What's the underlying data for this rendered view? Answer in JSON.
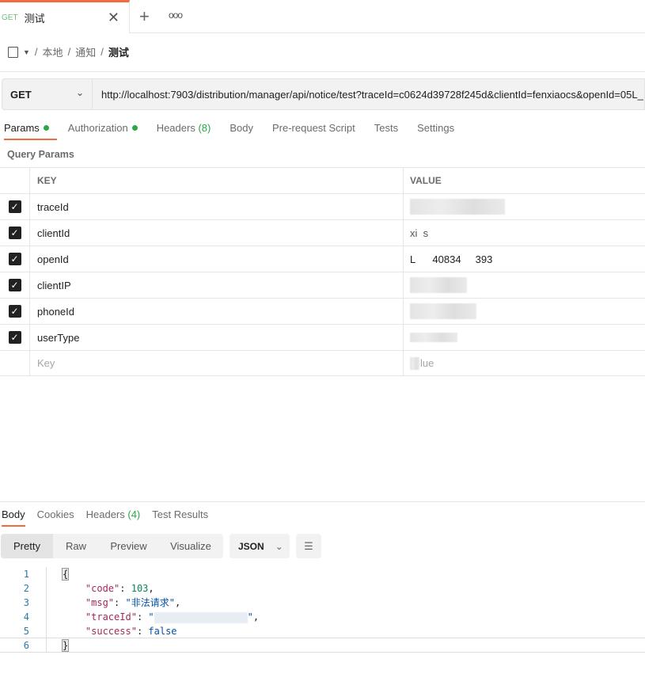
{
  "tab": {
    "method": "GET",
    "title": "测试",
    "close_icon": "close-icon",
    "new_tab_icon": "plus-icon",
    "more_icon": "ellipsis-icon"
  },
  "breadcrumb": {
    "items": [
      "本地",
      "通知"
    ],
    "current": "测试"
  },
  "request": {
    "method": "GET",
    "url": "http://localhost:7903/distribution/manager/api/notice/test?traceId=c0624d39728f245d&clientId=fenxiaocs&openId=05L_"
  },
  "tabs": [
    {
      "label": "Params"
    },
    {
      "label": "Authorization"
    },
    {
      "label": "Headers",
      "count": "(8)"
    },
    {
      "label": "Body"
    },
    {
      "label": "Pre-request Script"
    },
    {
      "label": "Tests"
    },
    {
      "label": "Settings"
    }
  ],
  "query_params": {
    "title": "Query Params",
    "headers": {
      "key": "KEY",
      "value": "VALUE"
    },
    "rows": [
      {
        "key": "traceId",
        "value": ""
      },
      {
        "key": "clientId",
        "value": "xi  s"
      },
      {
        "key": "openId",
        "value": "L      40834     393"
      },
      {
        "key": "clientIP",
        "value": ""
      },
      {
        "key": "phoneId",
        "value": ""
      },
      {
        "key": "userType",
        "value": ""
      }
    ],
    "placeholder": {
      "key": "Key",
      "value": "lue"
    }
  },
  "response": {
    "tabs": [
      {
        "label": "Body"
      },
      {
        "label": "Cookies"
      },
      {
        "label": "Headers",
        "count": "(4)"
      },
      {
        "label": "Test Results"
      }
    ],
    "views": [
      "Pretty",
      "Raw",
      "Preview",
      "Visualize"
    ],
    "format": "JSON",
    "body": {
      "code": "103",
      "msg": "\"非法请求\"",
      "success": "false"
    }
  },
  "colors": {
    "accent": "#f26b3a",
    "green": "#2aa748"
  }
}
